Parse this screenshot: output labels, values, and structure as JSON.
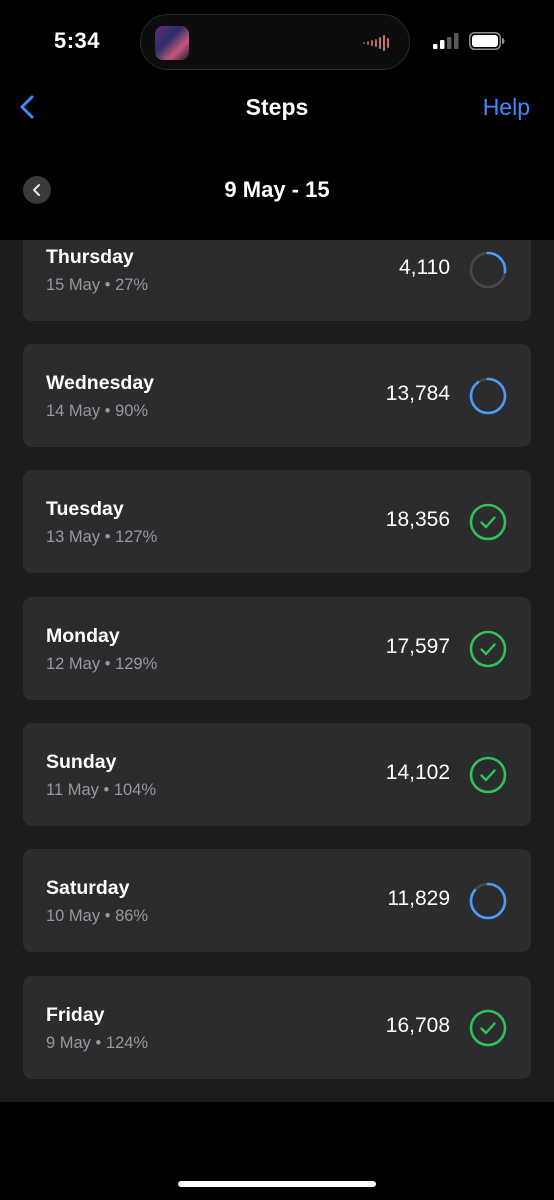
{
  "status_bar": {
    "time": "5:34",
    "icons": [
      "album-art-icon",
      "audio-waveform-icon",
      "signal-icon",
      "battery-icon"
    ]
  },
  "nav": {
    "back_icon": "chevron-left-icon",
    "title": "Steps",
    "help_label": "Help"
  },
  "week": {
    "prev_icon": "chevron-left-icon",
    "range": "9 May - 15"
  },
  "colors": {
    "accent": "#3d8bff",
    "progress_ring": "#4a9df8",
    "goal_met": "#30c25a",
    "card": "#2c2c2e"
  },
  "days": [
    {
      "day": "Thursday",
      "date": "15 May",
      "percent": "27%",
      "steps": "4,110",
      "status": "in-progress",
      "progress": 0.27
    },
    {
      "day": "Wednesday",
      "date": "14 May",
      "percent": "90%",
      "steps": "13,784",
      "status": "in-progress",
      "progress": 0.9
    },
    {
      "day": "Tuesday",
      "date": "13 May",
      "percent": "127%",
      "steps": "18,356",
      "status": "goal-met",
      "progress": 1.27
    },
    {
      "day": "Monday",
      "date": "12 May",
      "percent": "129%",
      "steps": "17,597",
      "status": "goal-met",
      "progress": 1.29
    },
    {
      "day": "Sunday",
      "date": "11 May",
      "percent": "104%",
      "steps": "14,102",
      "status": "goal-met",
      "progress": 1.04
    },
    {
      "day": "Saturday",
      "date": "10 May",
      "percent": "86%",
      "steps": "11,829",
      "status": "in-progress",
      "progress": 0.86
    },
    {
      "day": "Friday",
      "date": "9 May",
      "percent": "124%",
      "steps": "16,708",
      "status": "goal-met",
      "progress": 1.24
    }
  ]
}
